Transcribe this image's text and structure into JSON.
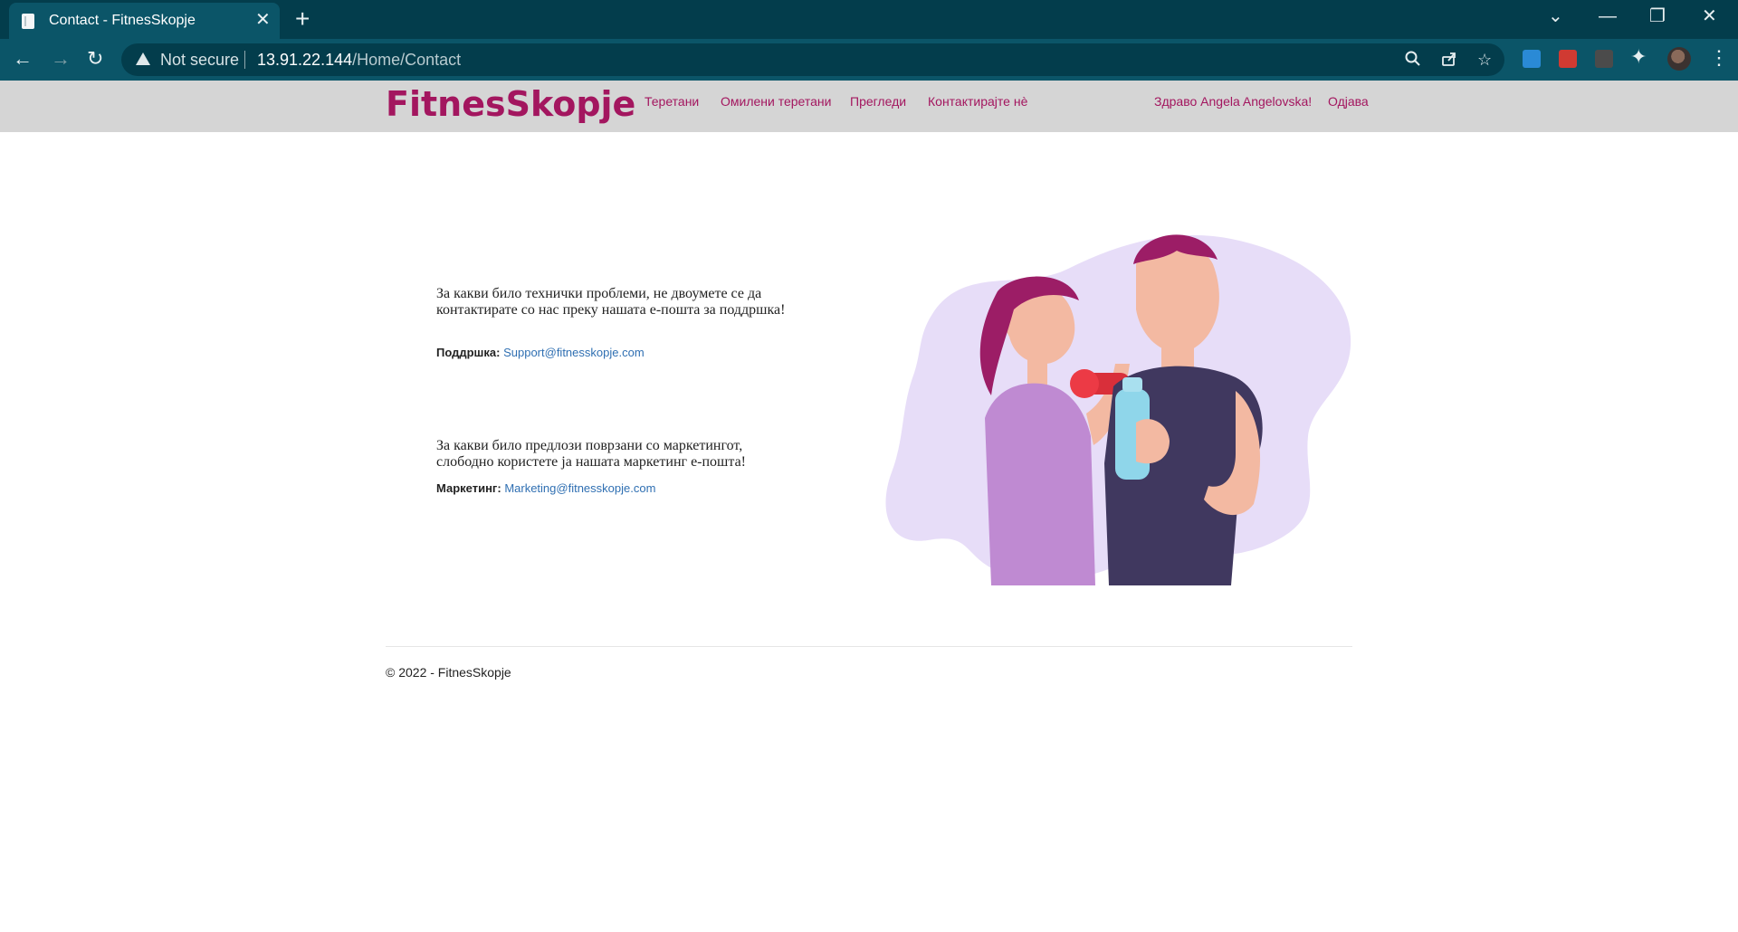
{
  "browser": {
    "tab_title": "Contact - FitnesSkopje",
    "tab_close": "✕",
    "new_tab": "+",
    "security_label": "Not secure",
    "url_host": "13.91.22.144",
    "url_path": "/Home/Contact",
    "icons": [
      "back-icon",
      "forward-icon",
      "reload-icon",
      "warning-icon",
      "zoom-icon",
      "share-icon",
      "star-icon",
      "extension-icon",
      "profile-avatar",
      "menu-icon"
    ]
  },
  "site": {
    "brand": "FitnesSkopje",
    "brand_color": "#a3165f",
    "nav": [
      "Теретани",
      "Омилени теретани",
      "Прегледи",
      "Контактирајте нè"
    ],
    "greeting": "Здраво Angela Angelovska!",
    "logout": "Одјава"
  },
  "contact": {
    "support_text": "За какви било технички проблеми, не двоумете се да контактирате со нас преку нашата е-пошта за поддршка!",
    "support_label": "Поддршка:",
    "support_email": "Support@fitnesskopje.com",
    "marketing_text": "За какви било предлози поврзани со маркетингот, слободно користете ја нашата маркетинг е-пошта!",
    "marketing_label": "Маркетинг:",
    "marketing_email": "Marketing@fitnesskopje.com"
  },
  "footer": {
    "copyright": "© 2022 - FitnesSkopje"
  }
}
